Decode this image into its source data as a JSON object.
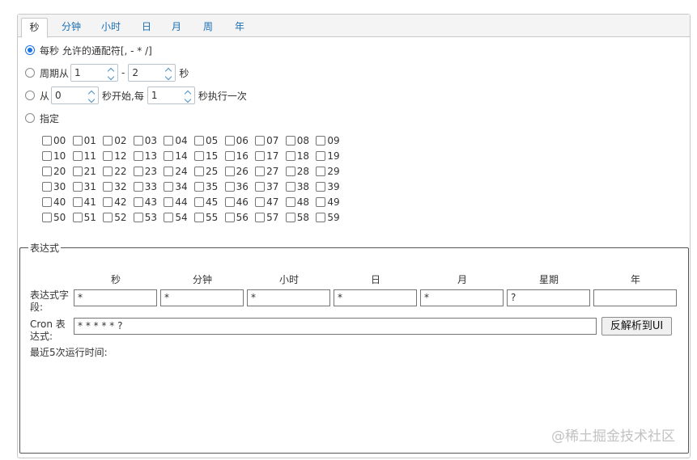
{
  "tabs": [
    "秒",
    "分钟",
    "小时",
    "日",
    "月",
    "周",
    "年"
  ],
  "options": {
    "every": "每秒 允许的通配符[, - * /]",
    "period_prefix": "周期从",
    "period_from": "1",
    "period_dash": "-",
    "period_to": "2",
    "period_unit": "秒",
    "start_prefix": "从",
    "start_value": "0",
    "start_mid": "秒开始,每",
    "step_value": "1",
    "step_suffix": "秒执行一次",
    "specify": "指定"
  },
  "checkboxes": [
    "00",
    "01",
    "02",
    "03",
    "04",
    "05",
    "06",
    "07",
    "08",
    "09",
    "10",
    "11",
    "12",
    "13",
    "14",
    "15",
    "16",
    "17",
    "18",
    "19",
    "20",
    "21",
    "22",
    "23",
    "24",
    "25",
    "26",
    "27",
    "28",
    "29",
    "30",
    "31",
    "32",
    "33",
    "34",
    "35",
    "36",
    "37",
    "38",
    "39",
    "40",
    "41",
    "42",
    "43",
    "44",
    "45",
    "46",
    "47",
    "48",
    "49",
    "50",
    "51",
    "52",
    "53",
    "54",
    "55",
    "56",
    "57",
    "58",
    "59"
  ],
  "expression": {
    "legend": "表达式",
    "columns": [
      "秒",
      "分钟",
      "小时",
      "日",
      "月",
      "星期",
      "年"
    ],
    "field_label": "表达式字段:",
    "field_values": [
      "*",
      "*",
      "*",
      "*",
      "*",
      "?",
      ""
    ],
    "cron_label": "Cron 表达式:",
    "cron_value": "* * * * * ?",
    "reverse_button": "反解析到UI",
    "recent_label": "最近5次运行时间:"
  },
  "watermark": "@稀土掘金技术社区",
  "colors": {
    "accent": "#1a73e8",
    "tab_link": "#1a6fb5"
  }
}
